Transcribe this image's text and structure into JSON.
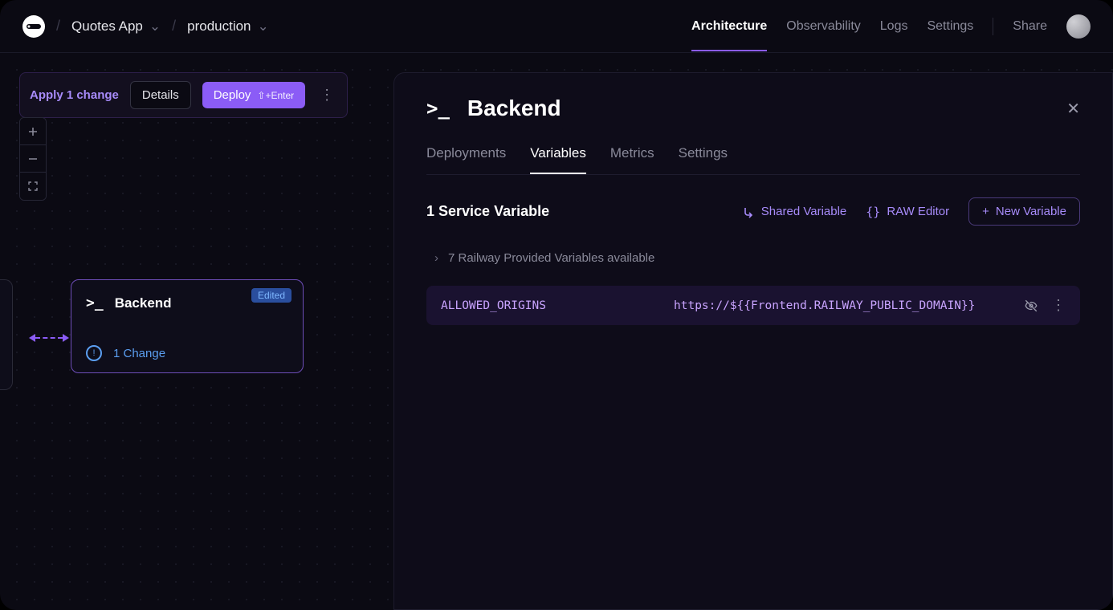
{
  "breadcrumb": {
    "project": "Quotes App",
    "environment": "production"
  },
  "nav": {
    "architecture": "Architecture",
    "observability": "Observability",
    "logs": "Logs",
    "settings": "Settings",
    "share": "Share"
  },
  "changes": {
    "label": "Apply 1 change",
    "details": "Details",
    "deploy": "Deploy",
    "shortcut": "⇧+Enter"
  },
  "service_node": {
    "badge": "Edited",
    "name": "Backend",
    "change_text": "1 Change"
  },
  "panel": {
    "title": "Backend",
    "tabs": {
      "deployments": "Deployments",
      "variables": "Variables",
      "metrics": "Metrics",
      "settings": "Settings"
    },
    "active_tab": "variables",
    "variables": {
      "count_label": "1 Service Variable",
      "shared_label": "Shared Variable",
      "raw_label": "RAW Editor",
      "new_label": "New Variable",
      "provided_label": "7 Railway Provided Variables available",
      "rows": [
        {
          "key": "ALLOWED_ORIGINS",
          "value": "https://${{Frontend.RAILWAY_PUBLIC_DOMAIN}}"
        }
      ]
    }
  }
}
